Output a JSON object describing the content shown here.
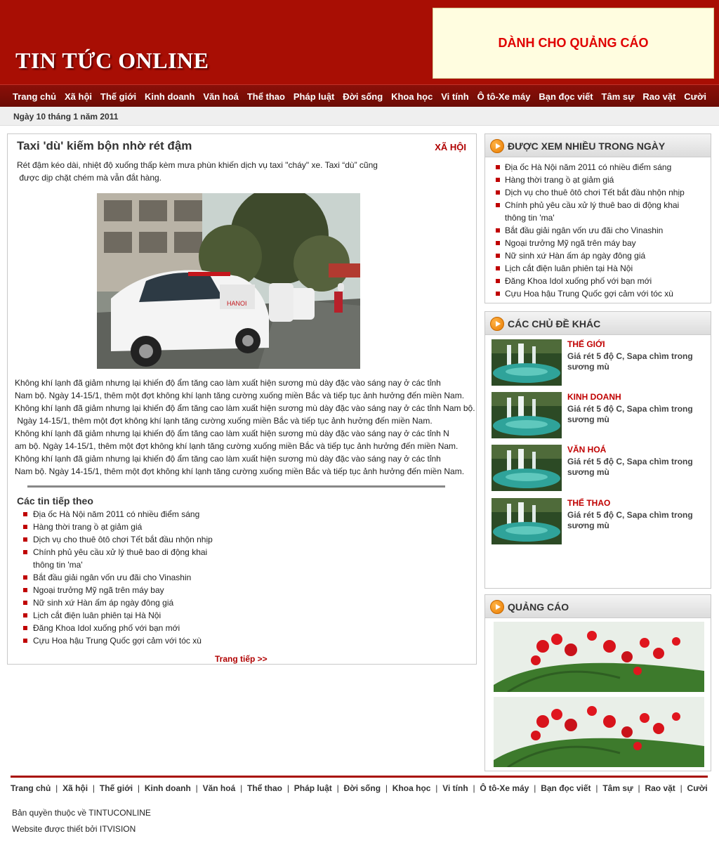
{
  "header": {
    "logo": "TIN TỨC ONLINE",
    "ad_text": "DÀNH CHO QUẢNG CÁO"
  },
  "nav": [
    "Trang chủ",
    "Xã hội",
    "Thế giới",
    "Kinh doanh",
    "Văn hoá",
    "Thể thao",
    "Pháp luật",
    "Đời sống",
    "Khoa học",
    "Vi tính",
    "Ô tô-Xe máy",
    "Bạn đọc viết",
    "Tâm sự",
    "Rao vặt",
    "Cười"
  ],
  "date": "Ngày 10 tháng 1 năm 2011",
  "article": {
    "title": "Taxi 'dù' kiếm bộn nhờ rét đậm",
    "category": "XÃ HỘI",
    "sapo_line1": "Rét đậm kéo dài, nhiệt độ xuống thấp kèm mưa phùn khiến dịch vụ taxi \"cháy\" xe. Taxi “dù” cũng",
    "sapo_line2": " được dịp chặt chém mà vẫn đắt hàng.",
    "body_lines": [
      "Không khí lạnh đã giảm nhưng lại khiến độ ẩm tăng cao làm xuất hiện sương mù dày đặc vào sáng nay ở các tỉnh",
      "Nam bộ. Ngày 14-15/1, thêm một đợt không khí lạnh tăng cường xuống miền Bắc và tiếp tục ảnh hưởng đến miền Nam.",
      "Không khí lạnh đã giảm nhưng lại khiến độ ẩm tăng cao làm xuất hiện sương mù dày đặc vào sáng nay ở các tỉnh Nam bộ.",
      " Ngày 14-15/1, thêm một đợt không khí lạnh tăng cường xuống miền Bắc và tiếp tục ảnh hưởng đến miền Nam.",
      "Không khí lạnh đã giảm nhưng lại khiến độ ẩm tăng cao làm xuất hiện sương mù dày đặc vào sáng nay ở các tỉnh N",
      "am bộ. Ngày 14-15/1, thêm một đợt không khí lạnh tăng cường xuống miền Bắc và tiếp tục ảnh hưởng đến miền Nam.",
      "Không khí lạnh đã giảm nhưng lại khiến độ ẩm tăng cao làm xuất hiện sương mù dày đặc vào sáng nay ở các tỉnh",
      "Nam bộ. Ngày 14-15/1, thêm một đợt không khí lạnh tăng cường xuống miền Bắc và tiếp tục ảnh hưởng đến miền Nam."
    ],
    "next_title": "Các tin tiếp theo",
    "next_items": [
      "Địa ốc Hà Nội năm 2011 có nhiều điểm sáng",
      "Hàng thời trang ồ ạt giảm giá",
      "Dịch vụ cho thuê ôtô chơi Tết bắt đầu nhộn nhịp",
      "Chính phủ yêu cầu xử lý thuê bao di động khai thông tin 'ma'",
      "Bắt đầu giải ngân vốn ưu đãi cho Vinashin",
      "Ngoại trưởng Mỹ ngã trên máy bay",
      "Nữ sinh xứ Hàn ấm áp ngày đông giá",
      "Lịch cắt điện luân phiên tại Hà Nội",
      "Đăng Khoa Idol xuống phố với bạn mới",
      "Cựu Hoa hậu Trung Quốc gợi cảm với tóc xù"
    ],
    "more_link": "Trang tiếp >>"
  },
  "sidebar": {
    "most_viewed": {
      "title": "ĐƯỢC XEM NHIỀU TRONG NGÀY",
      "items": [
        "Địa ốc Hà Nội năm 2011 có nhiều điểm sáng",
        "Hàng thời trang ồ ạt giảm giá",
        "Dịch vụ cho thuê ôtô chơi Tết bắt đầu nhộn nhịp",
        "Chính phủ yêu cầu xử lý thuê bao di động khai thông tin 'ma'",
        "Bắt đầu giải ngân vốn ưu đãi cho Vinashin",
        "Ngoại trưởng Mỹ ngã trên máy bay",
        "Nữ sinh xứ Hàn ấm áp ngày đông giá",
        "Lịch cắt điện luân phiên tại Hà Nội",
        "Đăng Khoa Idol xuống phố với bạn mới",
        "Cựu Hoa hậu Trung Quốc gợi cảm với tóc xù"
      ]
    },
    "other_topics": {
      "title": "CÁC CHỦ ĐỀ KHÁC",
      "items": [
        {
          "category": "THẾ GIỚI",
          "title": "Giá rét 5 độ C, Sapa chìm trong sương mù"
        },
        {
          "category": "KINH DOANH",
          "title": "Giá rét 5 độ C, Sapa chìm trong sương mù"
        },
        {
          "category": "VĂN HOÁ",
          "title": "Giá rét 5 độ C, Sapa chìm trong sương mù"
        },
        {
          "category": "THỂ THAO",
          "title": "Giá rét 5 độ C, Sapa chìm trong sương mù"
        }
      ]
    },
    "ads": {
      "title": "QUẢNG CÁO"
    }
  },
  "footer": {
    "nav": [
      "Trang chủ",
      "Xã hội",
      "Thế giới",
      "Kinh doanh",
      "Văn hoá",
      "Thể thao",
      "Pháp luật",
      "Đời sống",
      "Khoa học",
      "Vi tính",
      "Ô tô-Xe máy",
      "Bạn đọc viết",
      "Tâm sự",
      "Rao vặt",
      "Cười"
    ],
    "copyright": "Bản quyền thuộc về TINTUCONLINE",
    "designer": "Website được thiết bởi ITVISION"
  },
  "colors": {
    "brand_red": "#a80e04",
    "nav_dark": "#6c0c05",
    "accent_red": "#c00000",
    "ad_bg": "#fffde0"
  }
}
